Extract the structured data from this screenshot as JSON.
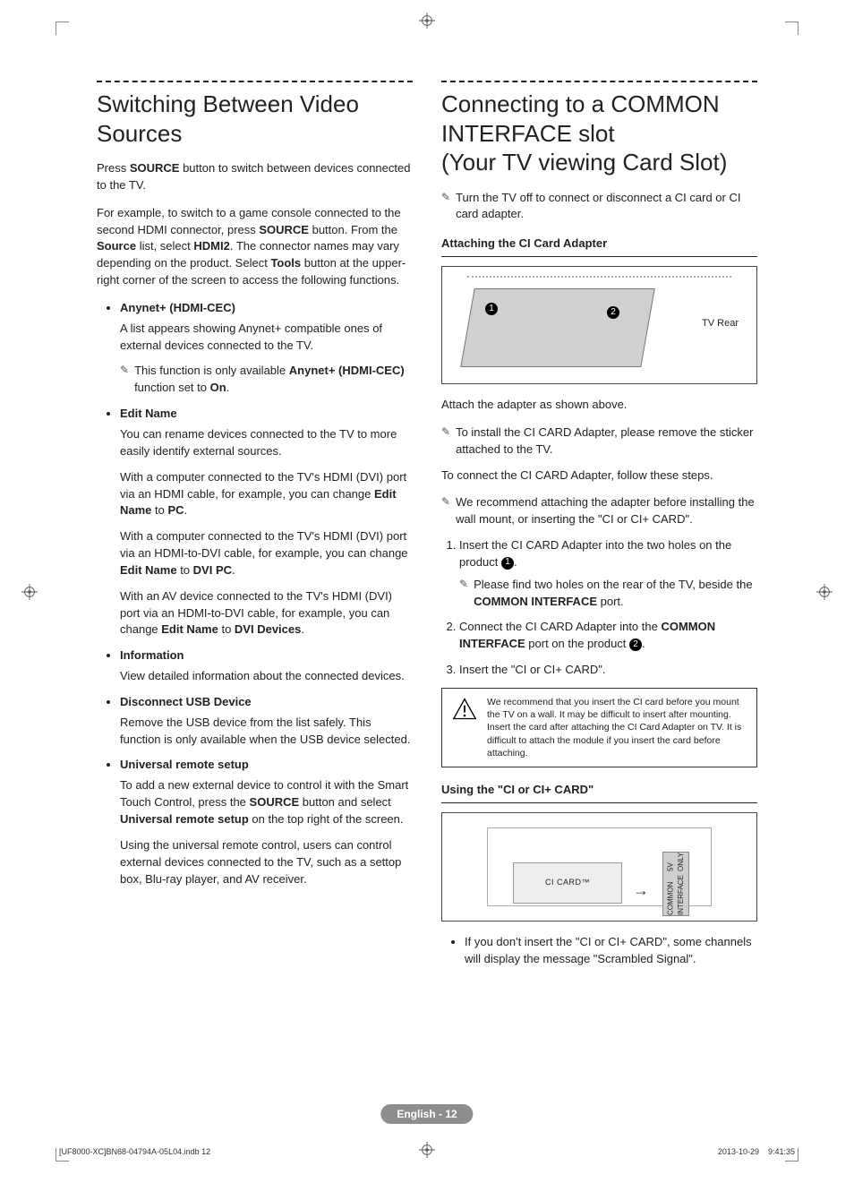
{
  "left": {
    "heading": "Switching Between Video Sources",
    "p1_a": "Press ",
    "p1_b": "SOURCE",
    "p1_c": " button to switch between devices connected to the TV.",
    "p2_a": "For example, to switch to a game console connected to the second HDMI connector, press ",
    "p2_b": "SOURCE",
    "p2_c": " button. From the ",
    "p2_d": "Source",
    "p2_e": " list, select ",
    "p2_f": "HDMI2",
    "p2_g": ". The connector names may vary depending on the product. Select ",
    "p2_h": "Tools",
    "p2_i": " button at the upper-right corner of the screen to access the following functions.",
    "items": {
      "anynet": {
        "title": "Anynet+ (HDMI-CEC)",
        "p": "A list appears showing Anynet+ compatible ones of external devices connected to the TV.",
        "note_a": "This function is only available ",
        "note_b": "Anynet+ (HDMI-CEC)",
        "note_c": " function set to ",
        "note_d": "On",
        "note_e": "."
      },
      "editname": {
        "title": "Edit Name",
        "p1": "You can rename devices connected to the TV to more easily identify external sources.",
        "p2_a": "With a computer connected to the TV's HDMI (DVI) port via an HDMI cable, for example, you can change ",
        "p2_b": "Edit Name",
        "p2_c": " to ",
        "p2_d": "PC",
        "p2_e": ".",
        "p3_a": "With a computer connected to the TV's HDMI (DVI) port via an HDMI-to-DVI cable, for example, you can change ",
        "p3_b": "Edit Name",
        "p3_c": " to ",
        "p3_d": "DVI PC",
        "p3_e": ".",
        "p4_a": "With an AV device connected to the TV's HDMI (DVI) port via an HDMI-to-DVI cable, for example, you can change ",
        "p4_b": "Edit Name",
        "p4_c": " to ",
        "p4_d": "DVI Devices",
        "p4_e": "."
      },
      "info": {
        "title": "Information",
        "p": "View detailed information about the connected devices."
      },
      "disconnect": {
        "title": "Disconnect USB Device",
        "p": "Remove the USB device from the list safely. This function is only available when the USB device selected."
      },
      "universal": {
        "title": "Universal remote setup",
        "p1_a": "To add a new external device to control it with the Smart Touch Control, press the ",
        "p1_b": "SOURCE",
        "p1_c": " button and select ",
        "p1_d": "Universal remote setup",
        "p1_e": " on the top right of the screen.",
        "p2": "Using the universal remote control, users can control external devices connected to the TV, such as a settop box, Blu-ray player, and AV receiver."
      }
    }
  },
  "right": {
    "heading": "Connecting to a COMMON INTERFACE slot\n(Your TV viewing Card Slot)",
    "note_top": "Turn the TV off to connect or disconnect a CI card or CI card adapter.",
    "sub1": "Attaching the CI Card Adapter",
    "fig1": {
      "label_tvrear": "TV Rear",
      "n1": "1",
      "n2": "2"
    },
    "p_attach": "Attach the adapter as shown above.",
    "note_install": "To install the CI CARD Adapter, please remove the sticker attached to the TV.",
    "p_connect": "To connect the CI CARD Adapter, follow these steps.",
    "note_recommend": "We recommend attaching the adapter before installing the wall mount, or inserting the \"CI or CI+ CARD\".",
    "steps": {
      "s1_a": "Insert the CI CARD Adapter into the two holes on the product ",
      "s1_num": "1",
      "s1_end": ".",
      "s1_note_a": "Please find two holes on the rear of the TV, beside the ",
      "s1_note_b": "COMMON INTERFACE",
      "s1_note_c": " port.",
      "s2_a": "Connect the CI CARD Adapter into the ",
      "s2_b": "COMMON INTERFACE",
      "s2_c": " port on the product ",
      "s2_num": "2",
      "s2_end": ".",
      "s3": "Insert the \"CI or CI+ CARD\"."
    },
    "warn": "We recommend that you insert the CI card before you mount the TV on a wall. It may be difficult to insert after mounting. Insert the card after attaching the CI Card Adapter on TV. It is difficult to attach the module if you insert the card before attaching.",
    "sub2": "Using the \"CI or CI+ CARD\"",
    "fig2": {
      "card_label": "CI CARD™",
      "slot_top": "COMMON INTERFACE",
      "slot_bottom": "5V ONLY",
      "arrow": "→"
    },
    "bullet_bottom": "If you don't insert the \"CI or CI+ CARD\", some channels will display the message \"Scrambled Signal\"."
  },
  "footer": {
    "badge": "English - 12",
    "left": "[UF8000-XC]BN68-04794A-05L04.indb   12",
    "right": "2013-10-29     9:41:35"
  }
}
